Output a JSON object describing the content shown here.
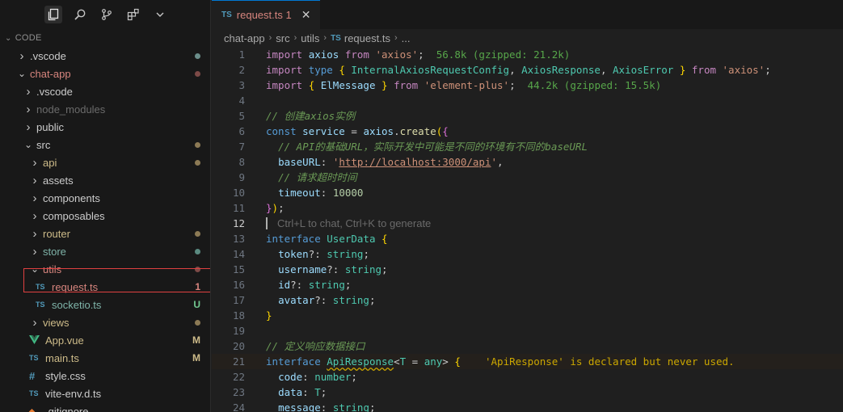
{
  "sidebar": {
    "section_title": "CODE",
    "tree": [
      {
        "label": ".vscode",
        "kind": "folder",
        "expanded": false,
        "depth": 0,
        "deco_type": "dot",
        "deco": "",
        "color": "#cccccc",
        "dot_color": "#6b8e8a",
        "icon": ""
      },
      {
        "label": "chat-app",
        "kind": "folder",
        "expanded": true,
        "depth": 0,
        "deco_type": "dot",
        "deco": "",
        "color": "#d7857e",
        "dot_color": "#7d4a47",
        "icon": ""
      },
      {
        "label": ".vscode",
        "kind": "folder",
        "expanded": false,
        "depth": 1,
        "deco_type": "",
        "deco": "",
        "color": "#cccccc",
        "dot_color": "",
        "icon": ""
      },
      {
        "label": "node_modules",
        "kind": "folder",
        "expanded": false,
        "depth": 1,
        "deco_type": "",
        "deco": "",
        "color": "#6b6b6b",
        "dot_color": "",
        "icon": ""
      },
      {
        "label": "public",
        "kind": "folder",
        "expanded": false,
        "depth": 1,
        "deco_type": "",
        "deco": "",
        "color": "#cccccc",
        "dot_color": "",
        "icon": ""
      },
      {
        "label": "src",
        "kind": "folder",
        "expanded": true,
        "depth": 1,
        "deco_type": "dot",
        "deco": "",
        "color": "#cccccc",
        "dot_color": "#8c7a55",
        "icon": ""
      },
      {
        "label": "api",
        "kind": "folder",
        "expanded": false,
        "depth": 2,
        "deco_type": "dot",
        "deco": "",
        "color": "#cdbb89",
        "dot_color": "#8c7a55",
        "icon": ""
      },
      {
        "label": "assets",
        "kind": "folder",
        "expanded": false,
        "depth": 2,
        "deco_type": "",
        "deco": "",
        "color": "#cccccc",
        "dot_color": "",
        "icon": ""
      },
      {
        "label": "components",
        "kind": "folder",
        "expanded": false,
        "depth": 2,
        "deco_type": "",
        "deco": "",
        "color": "#cccccc",
        "dot_color": "",
        "icon": ""
      },
      {
        "label": "composables",
        "kind": "folder",
        "expanded": false,
        "depth": 2,
        "deco_type": "",
        "deco": "",
        "color": "#cccccc",
        "dot_color": "",
        "icon": ""
      },
      {
        "label": "router",
        "kind": "folder",
        "expanded": false,
        "depth": 2,
        "deco_type": "dot",
        "deco": "",
        "color": "#cdbb89",
        "dot_color": "#8c7a55",
        "icon": ""
      },
      {
        "label": "store",
        "kind": "folder",
        "expanded": false,
        "depth": 2,
        "deco_type": "dot",
        "deco": "",
        "color": "#7fb4a9",
        "dot_color": "#5a8a80",
        "icon": ""
      },
      {
        "label": "utils",
        "kind": "folder",
        "expanded": true,
        "depth": 2,
        "deco_type": "dot",
        "deco": "",
        "color": "#d7857e",
        "dot_color": "#7d4a47",
        "icon": ""
      },
      {
        "label": "request.ts",
        "kind": "file",
        "expanded": false,
        "depth": 3,
        "deco_type": "text",
        "deco": "1",
        "color": "#d7857e",
        "dot_color": "#d7857e",
        "icon": "TS"
      },
      {
        "label": "socketio.ts",
        "kind": "file",
        "expanded": false,
        "depth": 3,
        "deco_type": "text",
        "deco": "U",
        "color": "#7fb4a9",
        "dot_color": "#73c991",
        "icon": "TS"
      },
      {
        "label": "views",
        "kind": "folder",
        "expanded": false,
        "depth": 2,
        "deco_type": "dot",
        "deco": "",
        "color": "#cdbb89",
        "dot_color": "#8c7a55",
        "icon": ""
      },
      {
        "label": "App.vue",
        "kind": "file",
        "expanded": false,
        "depth": 2,
        "deco_type": "text",
        "deco": "M",
        "color": "#cdbb89",
        "dot_color": "#cdbb89",
        "icon": "vue"
      },
      {
        "label": "main.ts",
        "kind": "file",
        "expanded": false,
        "depth": 2,
        "deco_type": "text",
        "deco": "M",
        "color": "#cdbb89",
        "dot_color": "#cdbb89",
        "icon": "TS"
      },
      {
        "label": "style.css",
        "kind": "file",
        "expanded": false,
        "depth": 2,
        "deco_type": "",
        "deco": "",
        "color": "#cccccc",
        "dot_color": "",
        "icon": "#"
      },
      {
        "label": "vite-env.d.ts",
        "kind": "file",
        "expanded": false,
        "depth": 2,
        "deco_type": "",
        "deco": "",
        "color": "#cccccc",
        "dot_color": "",
        "icon": "TS"
      },
      {
        "label": ".gitignore",
        "kind": "file",
        "expanded": false,
        "depth": 2,
        "deco_type": "",
        "deco": "",
        "color": "#cccccc",
        "dot_color": "",
        "icon": "git"
      }
    ]
  },
  "tab": {
    "icon": "TS",
    "title": "request.ts 1",
    "close": "✕"
  },
  "breadcrumb": {
    "parts": [
      "chat-app",
      "src",
      "utils"
    ],
    "file_icon": "TS",
    "file": "request.ts",
    "more": "..."
  },
  "editor": {
    "hint": "Ctrl+L to chat, Ctrl+K to generate",
    "line_numbers": [
      "1",
      "2",
      "3",
      "4",
      "5",
      "6",
      "7",
      "8",
      "9",
      "10",
      "11",
      "12",
      "13",
      "14",
      "15",
      "16",
      "17",
      "18",
      "19",
      "20",
      "21",
      "22",
      "23",
      "24"
    ],
    "current_line": "12",
    "lines": [
      [
        [
          "kwc",
          "import "
        ],
        [
          "var",
          "axios "
        ],
        [
          "kwc",
          "from "
        ],
        [
          "str",
          "'axios'"
        ],
        [
          "pun",
          ";  "
        ],
        [
          "size",
          "56.8k (gzipped: 21.2k)"
        ]
      ],
      [
        [
          "kwc",
          "import "
        ],
        [
          "kw",
          "type "
        ],
        [
          "brk",
          "{ "
        ],
        [
          "cls",
          "InternalAxiosRequestConfig"
        ],
        [
          "pun",
          ", "
        ],
        [
          "cls",
          "AxiosResponse"
        ],
        [
          "pun",
          ", "
        ],
        [
          "cls",
          "AxiosError "
        ],
        [
          "brk",
          "} "
        ],
        [
          "kwc",
          "from "
        ],
        [
          "str",
          "'axios'"
        ],
        [
          "pun",
          ";"
        ]
      ],
      [
        [
          "kwc",
          "import "
        ],
        [
          "brk",
          "{ "
        ],
        [
          "var",
          "ElMessage "
        ],
        [
          "brk",
          "} "
        ],
        [
          "kwc",
          "from "
        ],
        [
          "str",
          "'element-plus'"
        ],
        [
          "pun",
          ";  "
        ],
        [
          "size",
          "44.2k (gzipped: 15.5k)"
        ]
      ],
      [],
      [
        [
          "cmt",
          "// 创建axios实例"
        ]
      ],
      [
        [
          "kw",
          "const "
        ],
        [
          "var",
          "service "
        ],
        [
          "pun",
          "= "
        ],
        [
          "var",
          "axios"
        ],
        [
          "pun",
          "."
        ],
        [
          "fn",
          "create"
        ],
        [
          "brk",
          "("
        ],
        [
          "brk2",
          "{"
        ]
      ],
      [
        [
          "pun",
          "  "
        ],
        [
          "cmt",
          "// API的基础URL，实际开发中可能是不同的环境有不同的baseURL"
        ]
      ],
      [
        [
          "pun",
          "  "
        ],
        [
          "var",
          "baseURL"
        ],
        [
          "pun",
          ": "
        ],
        [
          "str",
          "'"
        ],
        [
          "url",
          "http://localhost:3000/api"
        ],
        [
          "str",
          "'"
        ],
        [
          "pun",
          ","
        ]
      ],
      [
        [
          "pun",
          "  "
        ],
        [
          "cmt",
          "// 请求超时时间"
        ]
      ],
      [
        [
          "pun",
          "  "
        ],
        [
          "var",
          "timeout"
        ],
        [
          "pun",
          ": "
        ],
        [
          "num",
          "10000"
        ]
      ],
      [
        [
          "brk2",
          "}"
        ],
        [
          "brk",
          ")"
        ],
        [
          "pun",
          ";"
        ]
      ],
      [
        [
          "hint",
          "Ctrl+L to chat, Ctrl+K to generate"
        ]
      ],
      [
        [
          "kw",
          "interface "
        ],
        [
          "cls",
          "UserData "
        ],
        [
          "brk",
          "{"
        ]
      ],
      [
        [
          "pun",
          "  "
        ],
        [
          "var",
          "token"
        ],
        [
          "pun",
          "?: "
        ],
        [
          "cls",
          "string"
        ],
        [
          "pun",
          ";"
        ]
      ],
      [
        [
          "pun",
          "  "
        ],
        [
          "var",
          "username"
        ],
        [
          "pun",
          "?: "
        ],
        [
          "cls",
          "string"
        ],
        [
          "pun",
          ";"
        ]
      ],
      [
        [
          "pun",
          "  "
        ],
        [
          "var",
          "id"
        ],
        [
          "pun",
          "?: "
        ],
        [
          "cls",
          "string"
        ],
        [
          "pun",
          ";"
        ]
      ],
      [
        [
          "pun",
          "  "
        ],
        [
          "var",
          "avatar"
        ],
        [
          "pun",
          "?: "
        ],
        [
          "cls",
          "string"
        ],
        [
          "pun",
          ";"
        ]
      ],
      [
        [
          "brk",
          "}"
        ]
      ],
      [],
      [
        [
          "cmt",
          "// 定义响应数据接口"
        ]
      ],
      [
        [
          "kw",
          "interface "
        ],
        [
          "squig",
          "ApiResponse"
        ],
        [
          "pun",
          "<"
        ],
        [
          "cls",
          "T "
        ],
        [
          "pun",
          "= "
        ],
        [
          "cls",
          "any"
        ],
        [
          "pun",
          "> "
        ],
        [
          "brk",
          "{"
        ],
        [
          "pun",
          "    "
        ],
        [
          "diag",
          "'ApiResponse' is declared but never used."
        ]
      ],
      [
        [
          "pun",
          "  "
        ],
        [
          "var",
          "code"
        ],
        [
          "pun",
          ": "
        ],
        [
          "cls",
          "number"
        ],
        [
          "pun",
          ";"
        ]
      ],
      [
        [
          "pun",
          "  "
        ],
        [
          "var",
          "data"
        ],
        [
          "pun",
          ": "
        ],
        [
          "cls",
          "T"
        ],
        [
          "pun",
          ";"
        ]
      ],
      [
        [
          "pun",
          "  "
        ],
        [
          "var",
          "message"
        ],
        [
          "pun",
          ": "
        ],
        [
          "cls",
          "string"
        ],
        [
          "pun",
          ";"
        ]
      ]
    ]
  }
}
